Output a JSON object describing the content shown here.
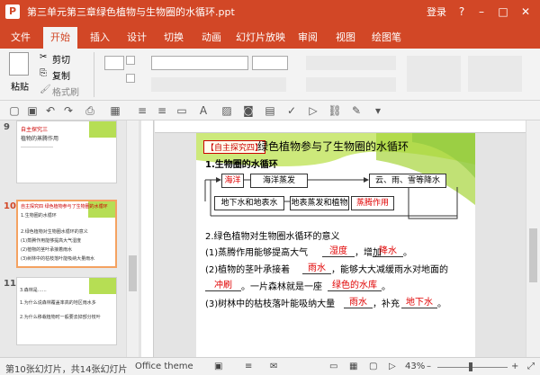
{
  "window": {
    "title": "第三单元第三章绿色植物与生物圈的水循环.ppt",
    "login": "登录",
    "app_icon": "P"
  },
  "tabs": [
    "文件",
    "开始",
    "插入",
    "设计",
    "切换",
    "动画",
    "幻灯片放映",
    "审阅",
    "视图",
    "绘图笔"
  ],
  "ribbon": {
    "paste": "粘贴",
    "cut": "剪切",
    "copy": "复制",
    "format_painter": "格式刷"
  },
  "thumbnails": [
    {
      "num": "9",
      "lines": [
        "自主探究三",
        "植物的蒸腾作用",
        "………………"
      ]
    },
    {
      "num": "10",
      "lines": [
        "自主探究四 绿色植物参与了生物圈的水循环",
        "1.生物圈的水循环",
        "2.绿色植物对生物圈水循环的意义",
        "(1)蒸腾作用能够提高大气湿度",
        "(2)植物的茎叶承接着雨水",
        "(3)树林中的枯枝落叶能吸纳大量雨水"
      ]
    },
    {
      "num": "11",
      "lines": [
        "3.森林是……",
        "1.为什么说森林覆盖率高的地区雨水多",
        "2.为什么移栽植物时一般要去掉部分枝叶"
      ]
    }
  ],
  "slide": {
    "title_tag": "【自主探究四】",
    "title": "绿色植物参与了生物圈的水循环",
    "sec1": "1.生物圈的水循环",
    "diagram": {
      "b1": "海洋",
      "b2": "海洋蒸发",
      "b3": "云、雨、雪等降水",
      "b4": "地下水和地表水",
      "b5": "地表蒸发和植物",
      "b6": "蒸腾作用"
    },
    "sec2": "2.绿色植物对生物圈水循环的意义",
    "l1a": "(1)蒸腾作用能够提高大气",
    "l1_ans1": "湿度",
    "l1b": "，增加",
    "l1_ans2": "降水",
    "l1c": "。",
    "l2a": "(2)植物的茎叶承接着",
    "l2_ans1": "雨水",
    "l2b": "，能够大大减缓雨水对地面的",
    "l3_ans1": "冲刷",
    "l3b": "。一片森林就是一座",
    "l3_ans2": "绿色的水库",
    "l3c": "。",
    "l4a": "(3)树林中的枯枝落叶能吸纳大量",
    "l4_ans1": "雨水",
    "l4b": "，补充",
    "l4_ans2": "地下水",
    "l4c": "。"
  },
  "status": {
    "slide_info": "第10张幻灯片，共14张幻灯片",
    "theme": "Office theme",
    "zoom": "43%"
  },
  "colors": {
    "accent": "#d24726",
    "answer": "#e00000",
    "slide_green": "#a6d43a"
  }
}
